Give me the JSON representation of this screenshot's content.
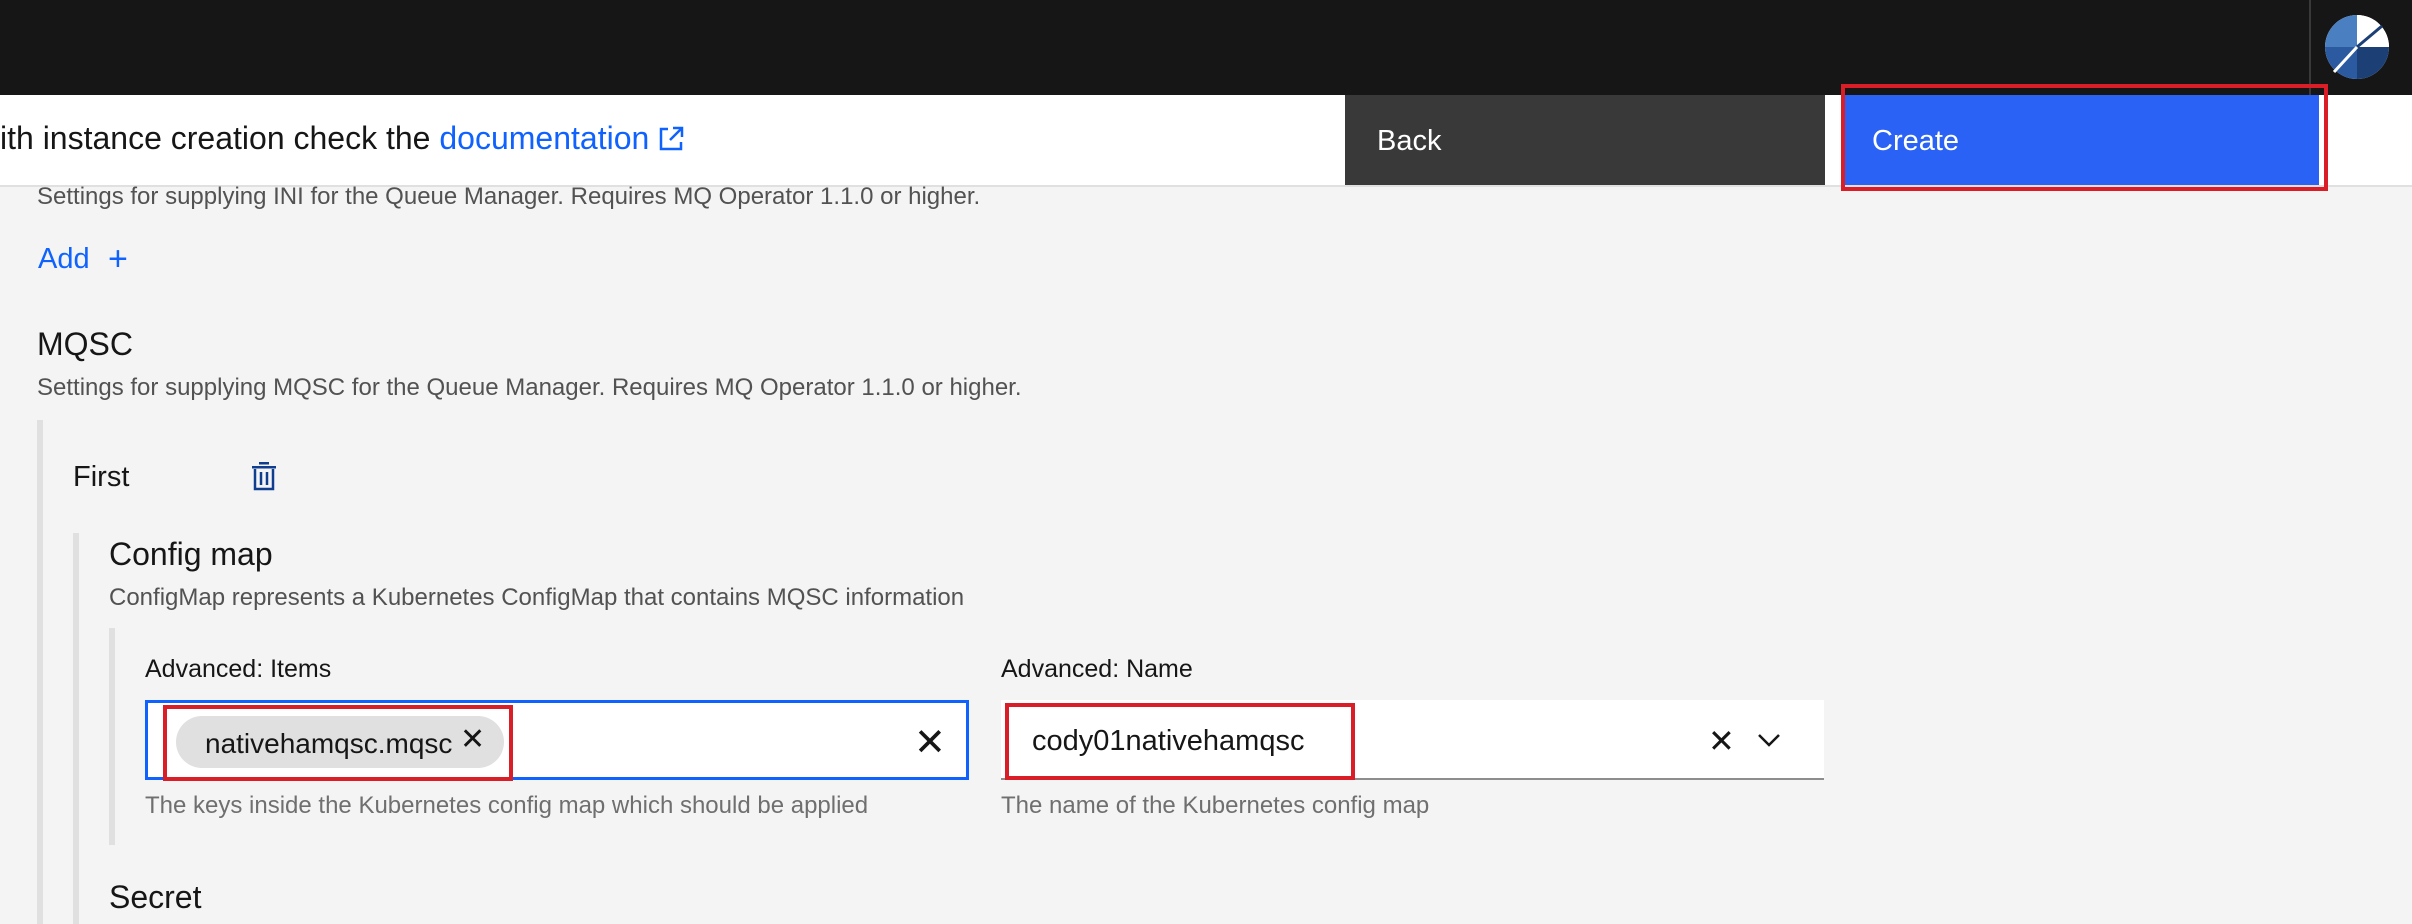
{
  "header": {
    "doc_prefix": "ith instance creation check the ",
    "doc_link": "documentation",
    "back_label": "Back",
    "create_label": "Create"
  },
  "ini": {
    "description": "Settings for supplying INI for the Queue Manager. Requires MQ Operator 1.1.0 or higher.",
    "add_label": "Add",
    "add_symbol": "+"
  },
  "mqsc": {
    "title": "MQSC",
    "description": "Settings for supplying MQSC for the Queue Manager. Requires MQ Operator 1.1.0 or higher.",
    "item_title": "First",
    "config_map": {
      "title": "Config map",
      "description": "ConfigMap represents a Kubernetes ConfigMap that contains MQSC information",
      "items": {
        "label": "Advanced: Items",
        "tag": "nativehamqsc.mqsc",
        "helper": "The keys inside the Kubernetes config map which should be applied"
      },
      "name": {
        "label": "Advanced: Name",
        "value": "cody01nativehamqsc",
        "helper": "The name of the Kubernetes config map"
      }
    },
    "secret_title": "Secret"
  },
  "icons": {
    "external_link": "external-link-icon",
    "trash": "trash-icon",
    "close": "close-icon",
    "chevron": "chevron-down-icon",
    "logo": "app-logo-icon"
  },
  "colors": {
    "primary": "#0f62fe",
    "create_button": "#2a62f5",
    "back_button": "#393939",
    "topbar": "#161616",
    "highlight": "#da1e28"
  }
}
